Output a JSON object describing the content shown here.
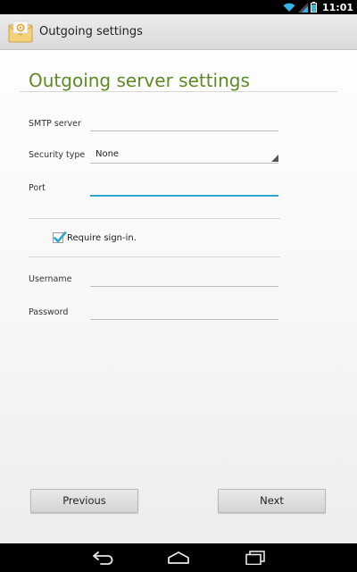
{
  "status_bar": {
    "time": "11:01"
  },
  "action_bar": {
    "title": "Outgoing settings",
    "app_icon": "email-app-icon"
  },
  "heading": "Outgoing server settings",
  "fields": {
    "smtp_server": {
      "label": "SMTP server",
      "value": ""
    },
    "security_type": {
      "label": "Security type",
      "value": "None"
    },
    "port": {
      "label": "Port",
      "value": ""
    },
    "require_signin": {
      "label": "Require sign-in.",
      "checked": true
    },
    "username": {
      "label": "Username",
      "value": ""
    },
    "password": {
      "label": "Password",
      "value": ""
    }
  },
  "buttons": {
    "previous": "Previous",
    "next": "Next"
  },
  "colors": {
    "heading": "#5f8a23",
    "focus_accent": "#2fa6d1",
    "checkbox_accent": "#2fa6d1"
  },
  "nav": {
    "back_icon": "back-icon",
    "home_icon": "home-icon",
    "recents_icon": "recents-icon"
  }
}
